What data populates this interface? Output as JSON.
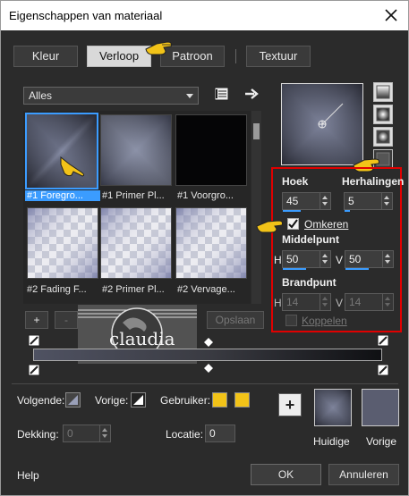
{
  "window": {
    "title": "Eigenschappen van materiaal"
  },
  "tabs": [
    {
      "label": "Kleur"
    },
    {
      "label": "Verloop"
    },
    {
      "label": "Patroon"
    },
    {
      "label": "Textuur"
    }
  ],
  "library": {
    "filter_value": "Alles"
  },
  "gallery": {
    "items": [
      {
        "label": "#1 Foregro..."
      },
      {
        "label": "#1 Primer Pl..."
      },
      {
        "label": "#1 Voorgro..."
      },
      {
        "label": "#2 Fading F..."
      },
      {
        "label": "#2 Primer Pl..."
      },
      {
        "label": "#2 Vervage..."
      }
    ]
  },
  "params": {
    "angle_label": "Hoek",
    "angle_value": "45",
    "repeats_label": "Herhalingen",
    "repeats_value": "5",
    "invert_label": "Omkeren",
    "center_label": "Middelpunt",
    "center_h_label": "H",
    "center_h_value": "50",
    "center_v_label": "V",
    "center_v_value": "50",
    "focal_label": "Brandpunt",
    "focal_h_label": "H",
    "focal_h_value": "14",
    "focal_v_label": "V",
    "focal_v_value": "14",
    "link_label": "Koppelen"
  },
  "editor": {
    "add_label": "+",
    "remove_label": "-",
    "save_label": "Opslaan",
    "watermark_text": "claudia"
  },
  "colors": {
    "next_label": "Volgende:",
    "prev_label": "Vorige:",
    "user_label": "Gebruiker:",
    "opacity_label": "Dekking:",
    "opacity_value": "0",
    "location_label": "Locatie:",
    "location_value": "0",
    "user_color": "#f2c318"
  },
  "swatches": {
    "add_label": "+",
    "current_label": "Huidige",
    "previous_label": "Vorige"
  },
  "footer": {
    "help_label": "Help",
    "ok_label": "OK",
    "cancel_label": "Annuleren"
  },
  "accent": "#3b9cff",
  "highlight_border": "#e00000"
}
